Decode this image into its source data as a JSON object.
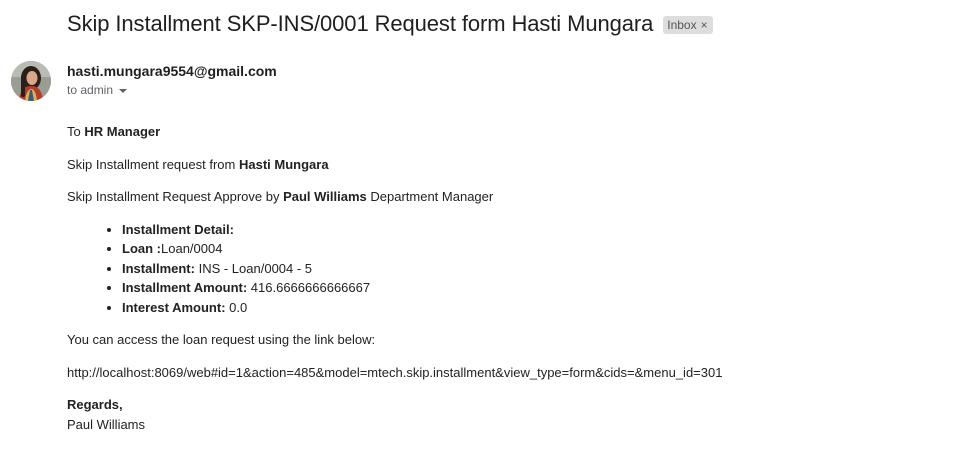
{
  "email": {
    "subject": "Skip Installment SKP-INS/0001 Request form Hasti Mungara",
    "label_chip": "Inbox",
    "label_close": "×",
    "sender": "hasti.mungara9554@gmail.com",
    "recipient": "to admin"
  },
  "body": {
    "greeting_prefix": "To",
    "greeting_name": "HR Manager",
    "request_prefix": "Skip Installment request from",
    "request_name": "Hasti Mungara",
    "approve_prefix": "Skip Installment Request Approve by",
    "approve_name": "Paul Williams",
    "approve_suffix": " Department Manager",
    "details": [
      {
        "label": "Installment Detail:",
        "value": ""
      },
      {
        "label": "Loan :",
        "value": "Loan/0004"
      },
      {
        "label": "Installment:",
        "value": " INS - Loan/0004 - 5"
      },
      {
        "label": "Installment Amount:",
        "value": " 416.6666666666667"
      },
      {
        "label": "Interest Amount:",
        "value": " 0.0"
      }
    ],
    "access_text": "You can access the loan request using the link below:",
    "link": "http://localhost:8069/web#id=1&action=485&model=mtech.skip.installment&view_type=form&cids=&menu_id=301",
    "regards": "Regards,",
    "signature": "Paul Williams"
  }
}
